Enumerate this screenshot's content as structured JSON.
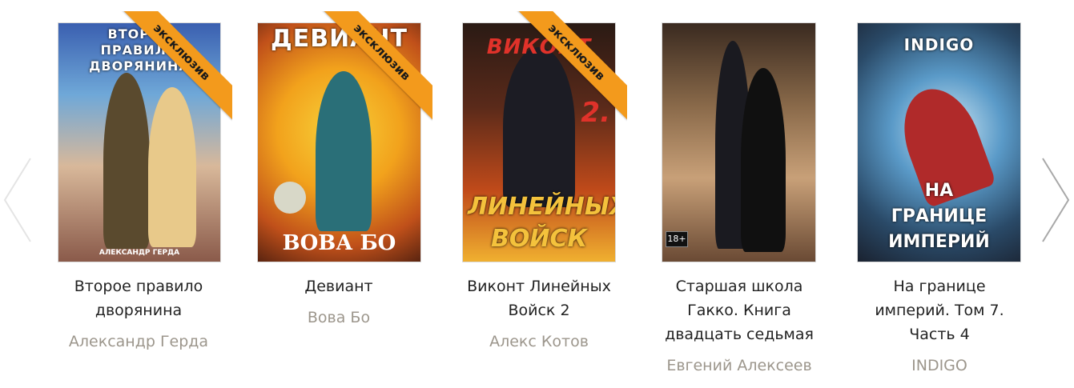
{
  "carousel": {
    "prev_icon": "chevron-left-icon",
    "next_icon": "chevron-right-icon",
    "books": [
      {
        "title": "Второе правило дворянина",
        "author": "Александр Герда",
        "badge": "эксклюзив",
        "cover_top_text": "ВТОРОЕ ПРАВИЛО ДВОРЯНИНА",
        "cover_bottom_text": "АЛЕКСАНДР ГЕРДА"
      },
      {
        "title": "Девиант",
        "author": "Вова Бо",
        "badge": "эксклюзив",
        "cover_top_text": "ДЕВИАНТ",
        "cover_bottom_text": "ВОВА БО"
      },
      {
        "title": "Виконт Линейных Войск 2",
        "author": "Алекс Котов",
        "badge": "эксклюзив",
        "cover_top_text": "ВИКОНТ",
        "cover_number": "2.",
        "cover_bottom_text": "ЛИНЕЙНЫХ ВОЙСК"
      },
      {
        "title": "Старшая школа Гакко. Книга двадцать седьмая",
        "author": "Евгений Алексеев",
        "cover_age": "18+"
      },
      {
        "title": "На границе империй. Том 7. Часть 4",
        "author": "INDIGO",
        "cover_top_text": "INDIGO",
        "cover_bottom_text": "НА ГРАНИЦЕ ИМПЕРИЙ"
      }
    ]
  }
}
